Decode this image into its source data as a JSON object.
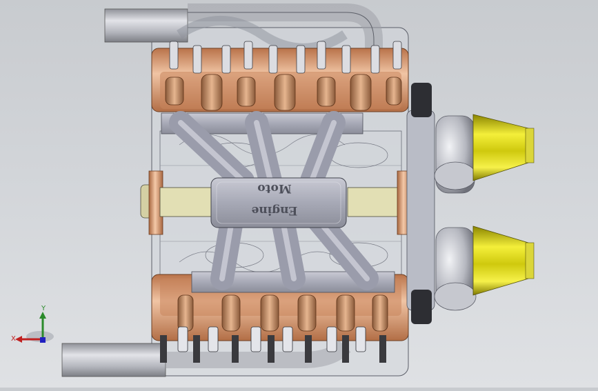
{
  "viewport": {
    "engraving": {
      "line1": "Moto",
      "line2": "Engine"
    }
  },
  "triad": {
    "x_label": "X",
    "y_label": "Y"
  },
  "colors": {
    "background": "#cfd2d6",
    "copper": "#d9a27c",
    "steel": "#a9abb6",
    "filter": "#e7e21c",
    "axis_x": "#c02020",
    "axis_y": "#2a8a2a",
    "axis_z": "#2020c0"
  }
}
